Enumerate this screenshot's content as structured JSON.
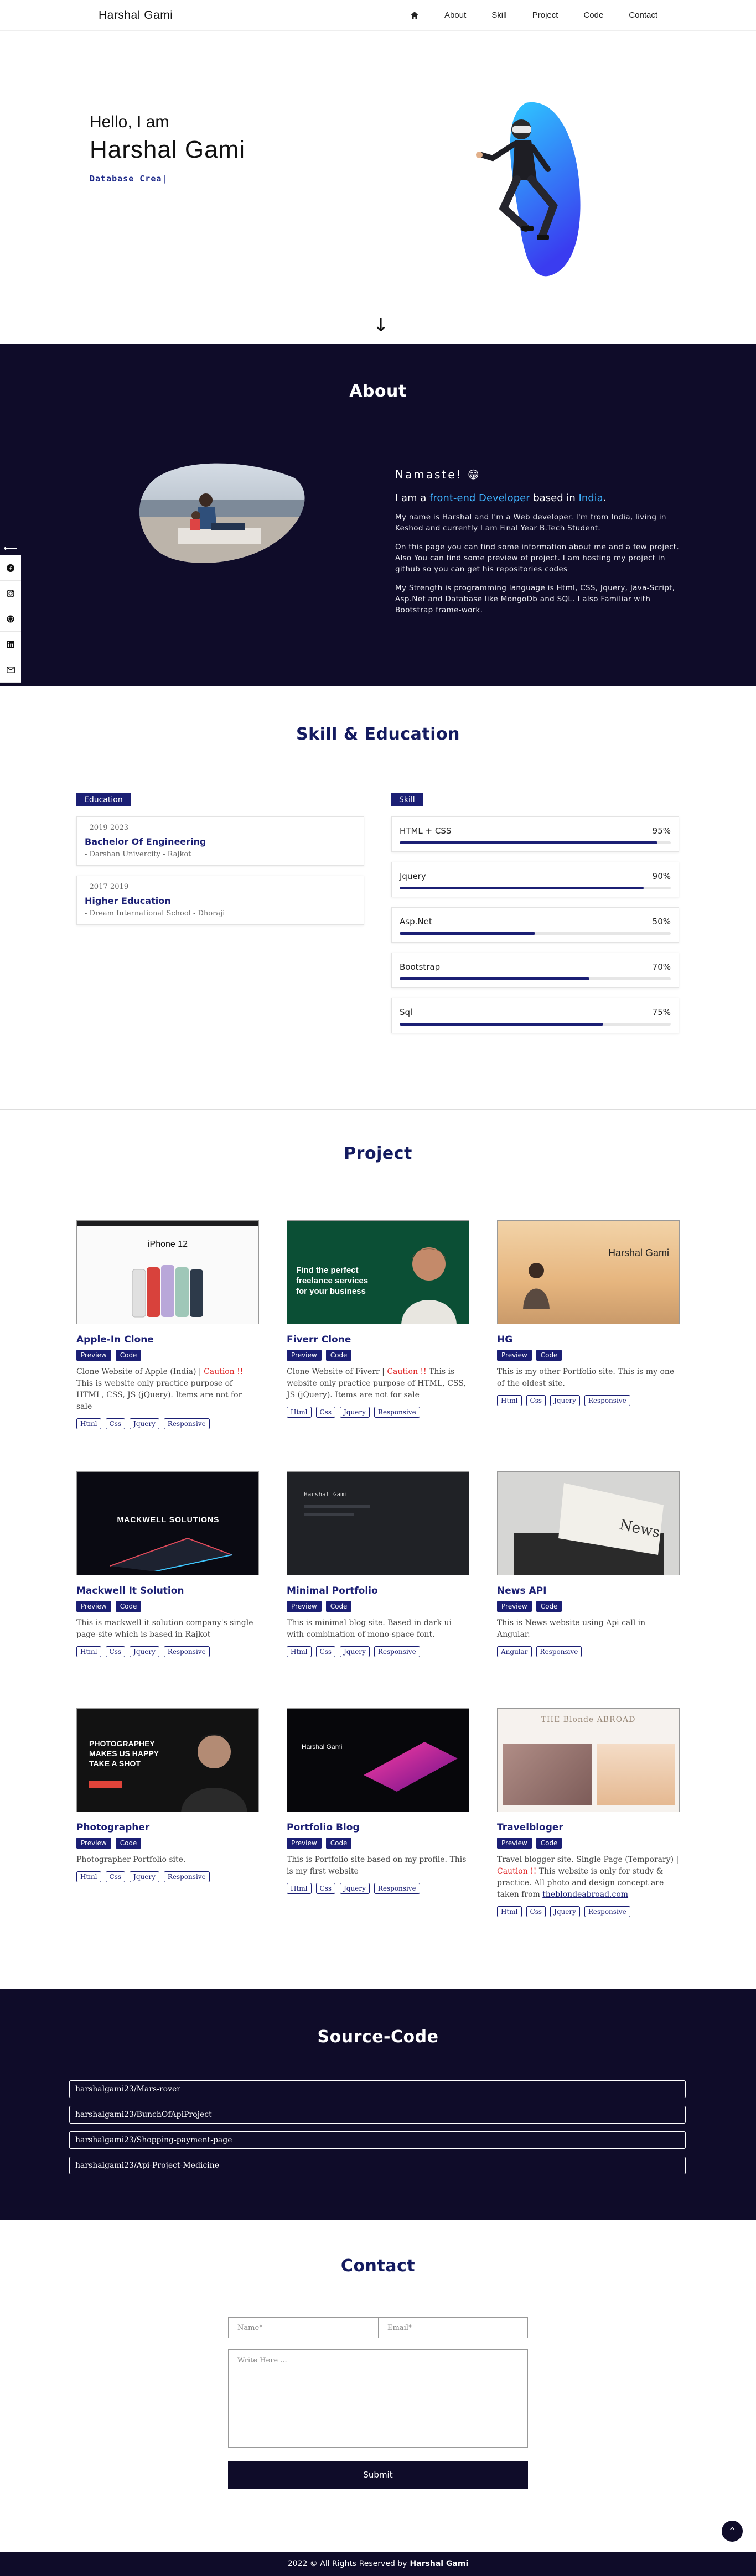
{
  "nav": {
    "brand": "Harshal Gami",
    "home_icon": "home-icon",
    "links": [
      "About",
      "Skill",
      "Project",
      "Code",
      "Contact"
    ]
  },
  "hero": {
    "greeting": "Hello, I am",
    "name": "Harshal Gami",
    "typed": "Database Crea|",
    "arrow": "↓"
  },
  "about": {
    "title": "About",
    "namaste": "Namaste! 😁",
    "iam_prefix": "I am a ",
    "iam_role": "front-end Developer",
    "iam_mid": " based in ",
    "iam_place": "India",
    "iam_suffix": ".",
    "p1": "My name is Harshal and I'm a Web developer. I'm from India, living in Keshod and currently I am Final Year B.Tech Student.",
    "p2": "On this page you can find some information about me and a few project. Also You can find some preview of project. I am hosting my project in github so you can get his repositories codes",
    "p3": "My Strength is programming language is Html, CSS, Jquery, Java-Script, Asp.Net and Database like MongoDb and SQL. I also Familiar with Bootstrap frame-work."
  },
  "social": {
    "toggle": "⟵",
    "icons": [
      "facebook-icon",
      "instagram-icon",
      "github-icon",
      "linkedin-icon",
      "mail-icon"
    ]
  },
  "skills_section": {
    "title": "Skill & Education",
    "education_label": "Education",
    "skill_label": "Skill",
    "education": [
      {
        "years": "- 2019-2023",
        "degree": "Bachelor Of Engineering",
        "school": "- Darshan Univercity - Rajkot"
      },
      {
        "years": "- 2017-2019",
        "degree": "Higher Education",
        "school": "- Dream International School - Dhoraji"
      }
    ],
    "skills": [
      {
        "name": "HTML + CSS",
        "pct_label": "95%",
        "pct": 95
      },
      {
        "name": "Jquery",
        "pct_label": "90%",
        "pct": 90
      },
      {
        "name": "Asp.Net",
        "pct_label": "50%",
        "pct": 50
      },
      {
        "name": "Bootstrap",
        "pct_label": "70%",
        "pct": 70
      },
      {
        "name": "Sql",
        "pct_label": "75%",
        "pct": 75
      }
    ]
  },
  "projects": {
    "title": "Project",
    "preview_label": "Preview",
    "code_label": "Code",
    "items": [
      {
        "title": "Apple-In Clone",
        "desc_a": "Clone Website of Apple (India) | ",
        "caution": "Caution !!",
        "desc_b": " This is website only practice purpose of HTML, CSS, JS (jQuery). Items are not for sale",
        "tags": [
          "Html",
          "Css",
          "Jquery",
          "Responsive"
        ],
        "thumb_text": "iPhone 12"
      },
      {
        "title": "Fiverr Clone",
        "desc_a": "Clone Website of Fiverr | ",
        "caution": "Caution !!",
        "desc_b": " This is website only practice purpose of HTML, CSS, JS (jQuery). Items are not for sale",
        "tags": [
          "Html",
          "Css",
          "Jquery",
          "Responsive"
        ],
        "thumb_text": "Find the perfect freelance services for your business"
      },
      {
        "title": "HG",
        "desc_a": "This is my other Portfolio site. This is my one of the oldest site.",
        "caution": "",
        "desc_b": "",
        "tags": [
          "Html",
          "Css",
          "Jquery",
          "Responsive"
        ],
        "thumb_text": "Harshal Gami"
      },
      {
        "title": "Mackwell It Solution",
        "desc_a": "This is mackwell it solution company's single page-site which is based in Rajkot",
        "caution": "",
        "desc_b": "",
        "tags": [
          "Html",
          "Css",
          "Jquery",
          "Responsive"
        ],
        "thumb_text": "MACKWELL SOLUTIONS"
      },
      {
        "title": "Minimal Portfolio",
        "desc_a": "This is minimal blog site. Based in dark ui with combination of mono-space font.",
        "caution": "",
        "desc_b": "",
        "tags": [
          "Html",
          "Css",
          "Jquery",
          "Responsive"
        ],
        "thumb_text": "Harshal Gami"
      },
      {
        "title": "News API",
        "desc_a": "This is News website using Api call in Angular.",
        "caution": "",
        "desc_b": "",
        "tags": [
          "Angular",
          "Responsive"
        ],
        "thumb_text": "News"
      },
      {
        "title": "Photographer",
        "desc_a": "Photographer Portfolio site.",
        "caution": "",
        "desc_b": "",
        "tags": [
          "Html",
          "Css",
          "Jquery",
          "Responsive"
        ],
        "thumb_text": "PHOTOGRAPHEY MAKES US HAPPY TAKE A SHOT"
      },
      {
        "title": "Portfolio Blog",
        "desc_a": "This is Portfolio site based on my profile. This is my first website",
        "caution": "",
        "desc_b": "",
        "tags": [
          "Html",
          "Css",
          "Jquery",
          "Responsive"
        ],
        "thumb_text": "Harshal Gami"
      },
      {
        "title": "Travelbloger",
        "desc_a": "Travel blogger site. Single Page (Temporary) | ",
        "caution": "Caution !!",
        "desc_b": " This website is only for study & practice. All photo and design concept are taken from ",
        "link": "theblondeabroad.com",
        "tags": [
          "Html",
          "Css",
          "Jquery",
          "Responsive"
        ],
        "thumb_text": "THE Blonde ABROAD"
      }
    ]
  },
  "source": {
    "title": "Source-Code",
    "repos": [
      "harshalgami23/Mars-rover",
      "harshalgami23/BunchOfApiProject",
      "harshalgami23/Shopping-payment-page",
      "harshalgami23/Api-Project-Medicine"
    ]
  },
  "contact": {
    "title": "Contact",
    "name_placeholder": "Name*",
    "email_placeholder": "Email*",
    "message_placeholder": "Write Here ...",
    "submit": "Submit",
    "to_top": "⌃"
  },
  "footer": {
    "text": "2022 © All Rights Reserved by",
    "author": "Harshal Gami"
  },
  "colors": {
    "navy": "#0f0c29",
    "accent": "#1b1f74",
    "link_blue": "#3fb3ff",
    "caution": "#e02424"
  }
}
